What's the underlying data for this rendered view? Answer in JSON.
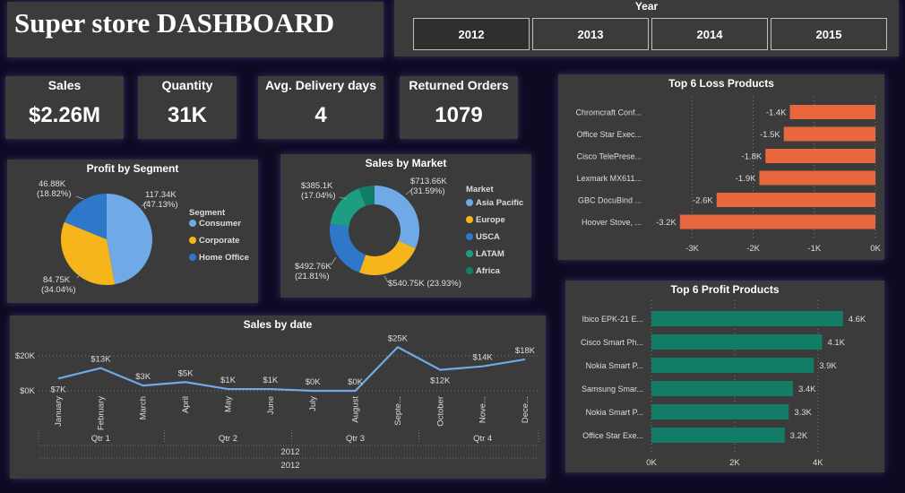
{
  "header": {
    "title": "Super store DASHBOARD"
  },
  "year_filter": {
    "label": "Year",
    "options": [
      "2012",
      "2013",
      "2014",
      "2015"
    ],
    "selected": "2012"
  },
  "kpis": {
    "sales": {
      "label": "Sales",
      "value": "$2.26M"
    },
    "quantity": {
      "label": "Quantity",
      "value": "31K"
    },
    "delivery": {
      "label": "Avg. Delivery days",
      "value": "4"
    },
    "returned": {
      "label": "Returned Orders",
      "value": "1079"
    }
  },
  "colors": {
    "background": "#0f0a24",
    "panel": "#3b3b3b",
    "consumer": "#6fa9e6",
    "corporate": "#f7b51c",
    "home_office": "#2f77c8",
    "usca": "#2f77c8",
    "latam": "#1d9e82",
    "africa": "#137c66",
    "loss_bar": "#e8673f",
    "profit_bar": "#137c66",
    "line": "#6fa9e6"
  },
  "chart_data": [
    {
      "id": "profit_by_segment",
      "type": "pie",
      "title": "Profit by Segment",
      "legend_title": "Segment",
      "legend_position": "right",
      "slices": [
        {
          "name": "Consumer",
          "value": 117340,
          "label": "117.34K",
          "pct": "(47.13%)"
        },
        {
          "name": "Corporate",
          "value": 84750,
          "label": "84.75K",
          "pct": "(34.04%)"
        },
        {
          "name": "Home Office",
          "value": 46880,
          "label": "46.88K",
          "pct": "(18.82%)"
        }
      ]
    },
    {
      "id": "sales_by_market",
      "type": "pie",
      "title": "Sales by Market",
      "legend_title": "Market",
      "legend_position": "right",
      "slices": [
        {
          "name": "Asia Pacific",
          "value": 713660,
          "label": "$713.66K",
          "pct": "(31.59%)"
        },
        {
          "name": "Europe",
          "value": 540750,
          "label": "$540.75K (23.93%)",
          "pct": ""
        },
        {
          "name": "USCA",
          "value": 492760,
          "label": "$492.76K",
          "pct": "(21.81%)"
        },
        {
          "name": "LATAM",
          "value": 385100,
          "label": "$385.1K",
          "pct": "(17.04%)"
        },
        {
          "name": "Africa",
          "value": 127000,
          "label": "",
          "pct": ""
        }
      ]
    },
    {
      "id": "top_loss_products",
      "type": "bar",
      "title": "Top 6 Loss Products",
      "categories": [
        "Chromcraft Conf...",
        "Office Star Exec...",
        "Cisco TelePrese...",
        "Lexmark MX611...",
        "GBC DocuBind ...",
        "Hoover Stove, ..."
      ],
      "values": [
        -1.4,
        -1.5,
        -1.8,
        -1.9,
        -2.6,
        -3.2
      ],
      "value_labels": [
        "-1.4K",
        "-1.5K",
        "-1.8K",
        "-1.9K",
        "-2.6K",
        "-3.2K"
      ],
      "xlim": [
        -3.3,
        0
      ],
      "xticks": [
        -3,
        -2,
        -1,
        0
      ],
      "xtick_labels": [
        "-3K",
        "-2K",
        "-1K",
        "0K"
      ]
    },
    {
      "id": "top_profit_products",
      "type": "bar",
      "title": "Top 6 Profit Products",
      "categories": [
        "Ibico EPK-21 E...",
        "Cisco Smart Ph...",
        "Nokia Smart P...",
        "Samsung Smar...",
        "Nokia Smart P...",
        "Office Star Exe..."
      ],
      "values": [
        4.6,
        4.1,
        3.9,
        3.4,
        3.3,
        3.2
      ],
      "value_labels": [
        "4.6K",
        "4.1K",
        "3.9K",
        "3.4K",
        "3.3K",
        "3.2K"
      ],
      "xlim": [
        0,
        4.8
      ],
      "xticks": [
        0,
        2,
        4
      ],
      "xtick_labels": [
        "0K",
        "2K",
        "4K"
      ]
    },
    {
      "id": "sales_by_date",
      "type": "line",
      "title": "Sales by date",
      "categories": [
        "January",
        "February",
        "March",
        "April",
        "May",
        "June",
        "July",
        "August",
        "Septe...",
        "October",
        "Nove...",
        "Dece..."
      ],
      "values": [
        7,
        13,
        3,
        5,
        1,
        1,
        0,
        0,
        25,
        12,
        14,
        18
      ],
      "value_labels": [
        "$7K",
        "$13K",
        "$3K",
        "$5K",
        "$1K",
        "$1K",
        "$0K",
        "$0K",
        "$25K",
        "$12K",
        "$14K",
        "$18K"
      ],
      "ylim": [
        0,
        20
      ],
      "yticks": [
        0,
        20
      ],
      "ytick_labels": [
        "$0K",
        "$20K"
      ],
      "quarters": [
        "Qtr 1",
        "Qtr 2",
        "Qtr 3",
        "Qtr 4"
      ],
      "year_labels": [
        "2012",
        "2012"
      ]
    }
  ]
}
